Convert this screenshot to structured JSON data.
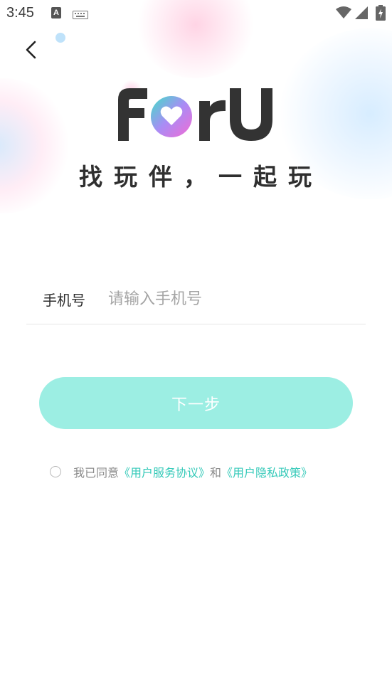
{
  "status_bar": {
    "time": "3:45",
    "notification_icon_letter": "A",
    "icons": [
      "a-notification-icon",
      "keyboard-icon",
      "wifi-icon",
      "signal-icon",
      "battery-icon"
    ]
  },
  "header": {
    "back_icon": "chevron-left-icon"
  },
  "brand": {
    "logo_text": "ForU",
    "slogan": "找玩伴，一起玩",
    "colors": {
      "logo_dark": "#333333",
      "heart_gradient_start": "#3fe0c6",
      "heart_gradient_mid": "#a98cf5",
      "heart_gradient_end": "#f26bd4"
    }
  },
  "form": {
    "phone_label": "手机号",
    "phone_placeholder": "请输入手机号",
    "phone_value": ""
  },
  "actions": {
    "next_label": "下一步",
    "next_color": "#9ceee3"
  },
  "agreement": {
    "checked": false,
    "prefix": "我已同意",
    "terms_link": "《用户服务协议》",
    "conjunction": "和",
    "privacy_link": "《用户隐私政策》",
    "link_color": "#33c9b8"
  }
}
